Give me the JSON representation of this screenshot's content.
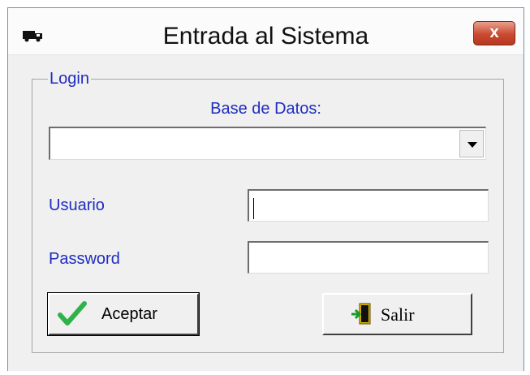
{
  "window": {
    "title": "Entrada al Sistema",
    "close_label": "x"
  },
  "login": {
    "group_label": "Login",
    "database_label": "Base de Datos:",
    "database_value": "",
    "user_label": "Usuario",
    "user_value": "",
    "password_label": "Password",
    "password_value": ""
  },
  "buttons": {
    "accept_label": "Aceptar",
    "exit_label": "Salir"
  },
  "icons": {
    "app": "truck-icon",
    "accept": "checkmark-icon",
    "exit": "exit-door-icon",
    "combo": "chevron-down-icon"
  },
  "colors": {
    "label_blue": "#1f2dbf",
    "close_red": "#c94a30",
    "check_green": "#2fb24a"
  }
}
